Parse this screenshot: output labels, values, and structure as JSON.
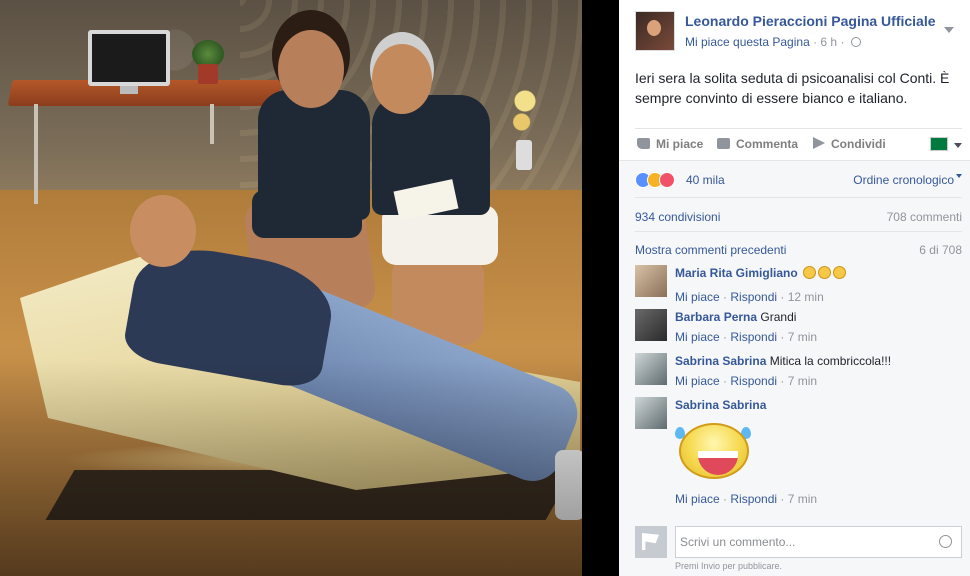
{
  "post": {
    "page_name": "Leonardo Pieraccioni Pagina Ufficiale",
    "meta_like": "Mi piace questa Pagina",
    "meta_sep": " · ",
    "meta_time": "6 h",
    "privacy_icon": "globe-icon",
    "text": "Ieri sera la solita seduta di psicoanalisi col Conti. È sempre convinto di essere bianco e italiano."
  },
  "actions": {
    "like": "Mi piace",
    "comment": "Commenta",
    "share": "Condividi"
  },
  "stats": {
    "reactions": "40 mila",
    "order": "Ordine cronologico",
    "shares": "934 condivisioni",
    "comments_count": "708 commenti",
    "show_previous": "Mostra commenti precedenti",
    "page_count": "6 di 708"
  },
  "comments": [
    {
      "author": "Maria Rita Gimigliano",
      "text": "",
      "emoji": "😂😂😂",
      "like": "Mi piace",
      "reply": "Rispondi",
      "time": "12 min"
    },
    {
      "author": "Barbara Perna",
      "text": "Grandi",
      "like": "Mi piace",
      "reply": "Rispondi",
      "time": "7 min"
    },
    {
      "author": "Sabrina Sabrina",
      "text": "Mitica la combriccola!!!",
      "like": "Mi piace",
      "reply": "Rispondi",
      "time": "7 min"
    },
    {
      "author": "Sabrina Sabrina",
      "text": "",
      "like": "Mi piace",
      "reply": "Rispondi",
      "time": "7 min"
    }
  ],
  "compose": {
    "placeholder": "Scrivi un commento...",
    "hint": "Premi Invio per pubblicare."
  },
  "separator": " · "
}
